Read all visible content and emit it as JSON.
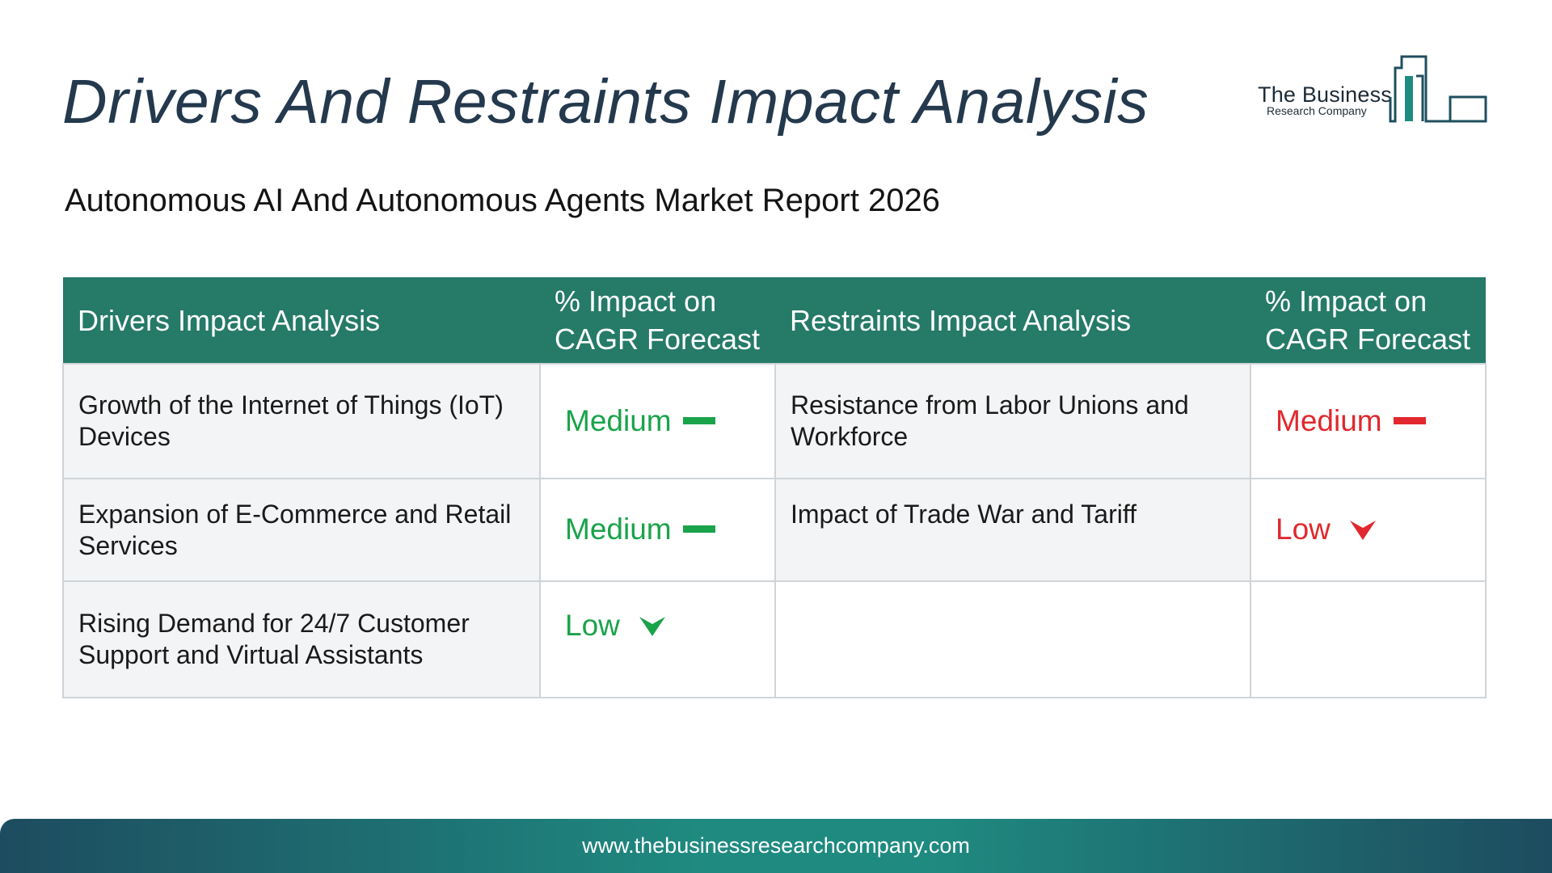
{
  "title": "Drivers And Restraints Impact Analysis",
  "subtitle": "Autonomous AI And Autonomous Agents Market Report 2026",
  "logo": {
    "name": "The Business",
    "sub": "Research Company"
  },
  "table": {
    "headers": {
      "drivers": "Drivers Impact Analysis",
      "drivers_impact": "% Impact on CAGR Forecast",
      "restraints": "Restraints Impact Analysis",
      "restraints_impact": "% Impact on CAGR Forecast"
    },
    "rows": [
      {
        "driver": "Growth of the Internet of Things (IoT) Devices",
        "driver_impact": "Medium",
        "driver_icon": "dash-icon",
        "restraint": "Resistance from Labor Unions and Workforce",
        "restraint_impact": "Medium",
        "restraint_icon": "dash-icon"
      },
      {
        "driver": "Expansion of E-Commerce and Retail Services",
        "driver_impact": "Medium",
        "driver_icon": "dash-icon",
        "restraint": "Impact of Trade War and Tariff",
        "restraint_impact": "Low",
        "restraint_icon": "down-arrow-icon"
      },
      {
        "driver": "Rising Demand for 24/7 Customer Support and Virtual Assistants",
        "driver_impact": "Low",
        "driver_icon": "down-arrow-icon",
        "restraint": "",
        "restraint_impact": "",
        "restraint_icon": ""
      }
    ]
  },
  "colors": {
    "header_bg": "#257a68",
    "driver_indicator": "#1aa34a",
    "restraint_indicator": "#e0282e",
    "title": "#24394d"
  },
  "footer": {
    "url": "www.thebusinessresearchcompany.com"
  }
}
